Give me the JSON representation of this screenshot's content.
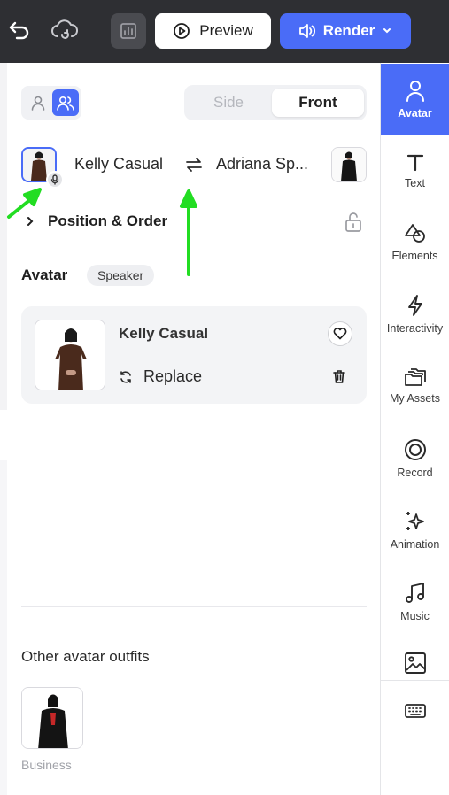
{
  "topbar": {
    "undo_icon": "undo-icon",
    "cloud_icon": "cloud-sync-icon",
    "stats_icon": "bar-chart-icon",
    "preview_label": "Preview",
    "render_label": "Render"
  },
  "mode_toggle": {
    "single_icon": "single-person-icon",
    "multi_icon": "two-people-icon",
    "selected": "multi"
  },
  "view": {
    "options": [
      "Side",
      "Front"
    ],
    "side_label": "Side",
    "front_label": "Front",
    "selected": "Front"
  },
  "speakers": {
    "first_name": "Kelly Casual",
    "second_name": "Adriana Sp...",
    "swap_icon": "swap-arrows-icon",
    "mic_icon": "microphone-icon"
  },
  "position_order": {
    "label": "Position & Order",
    "lock_icon": "unlock-icon"
  },
  "avatar_section": {
    "title": "Avatar",
    "badge": "Speaker",
    "card": {
      "name": "Kelly Casual",
      "replace_label": "Replace",
      "favorite_icon": "heart-icon",
      "delete_icon": "trash-icon"
    }
  },
  "other_outfits": {
    "title": "Other avatar outfits",
    "items": [
      {
        "label": "Business"
      }
    ]
  },
  "right_nav": {
    "items": [
      {
        "label": "Avatar",
        "icon": "person-icon",
        "active": true
      },
      {
        "label": "Text",
        "icon": "text-icon"
      },
      {
        "label": "Elements",
        "icon": "shapes-icon"
      },
      {
        "label": "Interactivity",
        "icon": "lightning-icon"
      },
      {
        "label": "My Assets",
        "icon": "folders-icon"
      },
      {
        "label": "Record",
        "icon": "record-icon"
      },
      {
        "label": "Animation",
        "icon": "sparkles-icon"
      },
      {
        "label": "Music",
        "icon": "music-note-icon"
      },
      {
        "label": "",
        "icon": "image-icon"
      }
    ],
    "keyboard_icon": "keyboard-icon"
  },
  "colors": {
    "accent": "#4a6cf7",
    "topbar": "#2e2f33",
    "annotation_arrow": "#22dd22"
  }
}
